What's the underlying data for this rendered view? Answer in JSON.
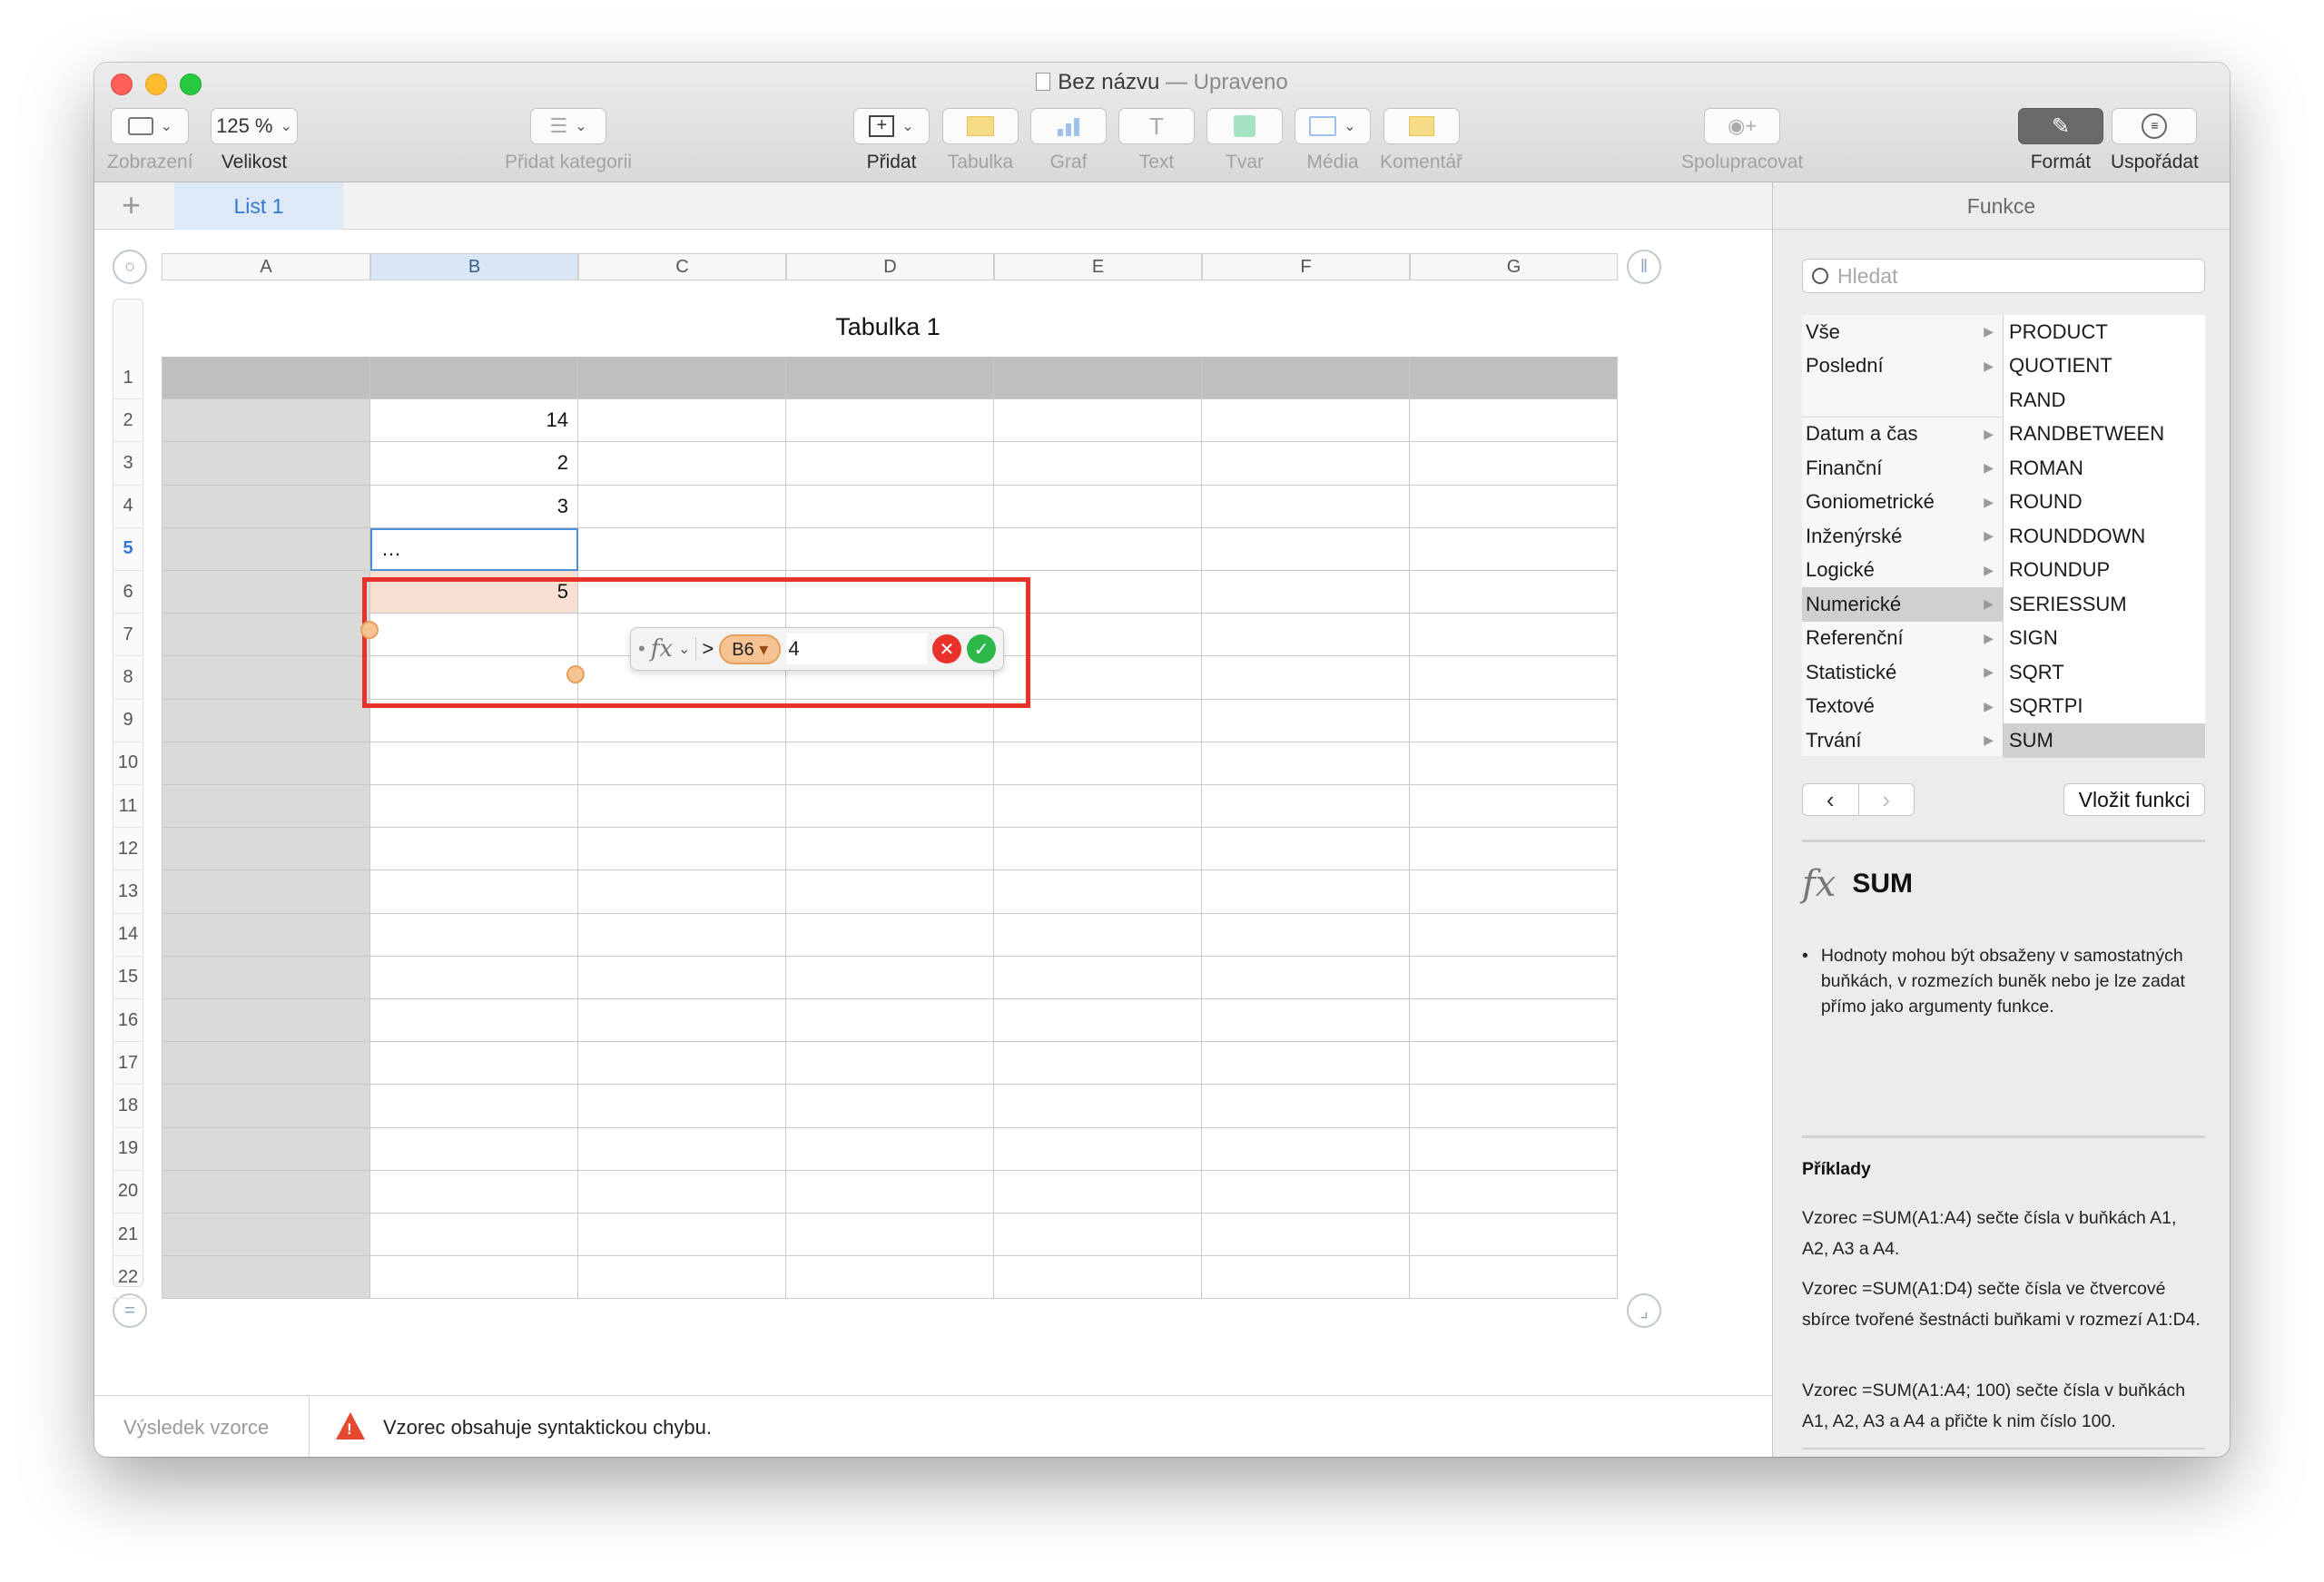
{
  "window": {
    "title": "Bez názvu",
    "title_separator": "—",
    "status_suffix": "Upraveno"
  },
  "toolbar": {
    "view_label": "Zobrazení",
    "zoom_value": "125 %",
    "zoom_label": "Velikost",
    "category_label": "Přidat kategorii",
    "add_label": "Přidat",
    "table_label": "Tabulka",
    "chart_label": "Graf",
    "text_label": "Text",
    "shape_label": "Tvar",
    "media_label": "Média",
    "comment_label": "Komentář",
    "collaborate_label": "Spolupracovat",
    "format_label": "Formát",
    "arrange_label": "Uspořádat"
  },
  "sheet_tabs": {
    "add": "+",
    "active": "List 1"
  },
  "table": {
    "title": "Tabulka 1",
    "columns": [
      "A",
      "B",
      "C",
      "D",
      "E",
      "F",
      "G"
    ],
    "selected_column": "B",
    "rows": [
      "1",
      "2",
      "3",
      "4",
      "5",
      "6",
      "7",
      "8",
      "9",
      "10",
      "11",
      "12",
      "13",
      "14",
      "15",
      "16",
      "17",
      "18",
      "19",
      "20",
      "21",
      "22"
    ],
    "selected_row": "5",
    "values_b": {
      "2": "14",
      "3": "2",
      "4": "3",
      "5": "…",
      "6": "5"
    }
  },
  "formula_editor": {
    "bullet": "•",
    "fx": "fx",
    "operator": ">",
    "token": "B6",
    "token_arrow": "▾",
    "rest": "4",
    "cancel": "✕",
    "confirm": "✓"
  },
  "status_bar": {
    "label": "Výsledek vzorce",
    "message": "Vzorec obsahuje syntaktickou chybu."
  },
  "panel": {
    "title": "Funkce",
    "search_placeholder": "Hledat",
    "categories": [
      {
        "label": "Vše"
      },
      {
        "label": "Poslední"
      },
      {
        "label": ""
      },
      {
        "label": "Datum a čas"
      },
      {
        "label": "Finanční"
      },
      {
        "label": "Goniometrické"
      },
      {
        "label": "Inženýrské"
      },
      {
        "label": "Logické"
      },
      {
        "label": "Numerické"
      },
      {
        "label": "Referenční"
      },
      {
        "label": "Statistické"
      },
      {
        "label": "Textové"
      },
      {
        "label": "Trvání"
      }
    ],
    "selected_category": "Numerické",
    "functions": [
      "PRODUCT",
      "QUOTIENT",
      "RAND",
      "RANDBETWEEN",
      "ROMAN",
      "ROUND",
      "ROUNDDOWN",
      "ROUNDUP",
      "SERIESSUM",
      "SIGN",
      "SQRT",
      "SQRTPI",
      "SUM"
    ],
    "selected_function": "SUM",
    "insert_button": "Vložit funkci",
    "detail_fx": "fx",
    "detail_name": "SUM",
    "bullet_text": "Hodnoty mohou být obsaženy v samostatných buňkách, v rozmezích buněk nebo je lze zadat přímo jako argumenty funkce.",
    "examples_heading": "Příklady",
    "examples": [
      "Vzorec =SUM(A1:A4) sečte čísla v buňkách A1, A2, A3 a A4.",
      "Vzorec =SUM(A1:D4) sečte čísla ve čtvercové sbírce tvořené šestnácti buňkami v rozmezí A1:D4.",
      "Vzorec =SUM(A1:A4; 100) sečte čísla v buňkách A1, A2, A3 a A4 a přičte k nim číslo 100."
    ]
  },
  "colors": {
    "highlight": "#e8332a",
    "accent": "#3478d4",
    "token": "#f6c493"
  }
}
